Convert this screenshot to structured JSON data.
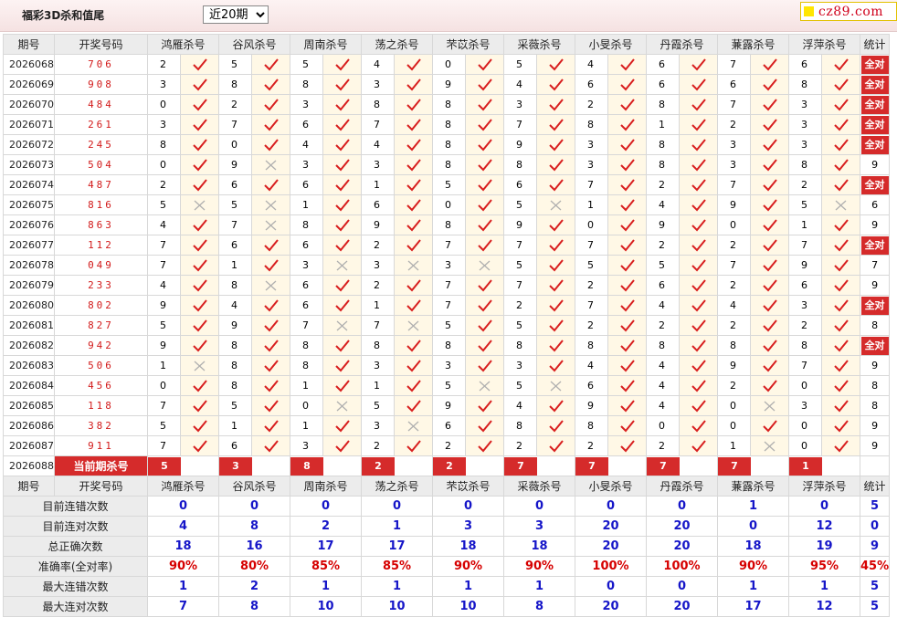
{
  "header": {
    "title": "福彩3D杀和值尾",
    "period_select": {
      "value": "近20期",
      "options": [
        "近20期"
      ]
    },
    "logo_text": "cz89.com"
  },
  "colors": {
    "accent": "#d52b2b",
    "stat_blue": "#1515c8",
    "check": "#d81e1e",
    "cross": "#b0b0b0",
    "mark_bg": "#fff8e6"
  },
  "table": {
    "columns": {
      "issue": "期号",
      "draw": "开奖号码",
      "stat": "统计"
    },
    "experts": [
      "鸿雁杀号",
      "谷风杀号",
      "周南杀号",
      "荡之杀号",
      "芣苡杀号",
      "采薇杀号",
      "小旻杀号",
      "丹霞杀号",
      "蒹露杀号",
      "浮萍杀号"
    ],
    "rows": [
      {
        "issue": "2026068",
        "draw": "706",
        "picks": [
          [
            "2",
            "hit"
          ],
          [
            "5",
            "hit"
          ],
          [
            "5",
            "hit"
          ],
          [
            "4",
            "hit"
          ],
          [
            "0",
            "hit"
          ],
          [
            "5",
            "hit"
          ],
          [
            "4",
            "hit"
          ],
          [
            "6",
            "hit"
          ],
          [
            "7",
            "hit"
          ],
          [
            "6",
            "hit"
          ]
        ],
        "stat": "全对",
        "all": true
      },
      {
        "issue": "2026069",
        "draw": "908",
        "picks": [
          [
            "3",
            "hit"
          ],
          [
            "8",
            "hit"
          ],
          [
            "8",
            "hit"
          ],
          [
            "3",
            "hit"
          ],
          [
            "9",
            "hit"
          ],
          [
            "4",
            "hit"
          ],
          [
            "6",
            "hit"
          ],
          [
            "6",
            "hit"
          ],
          [
            "6",
            "hit"
          ],
          [
            "8",
            "hit"
          ]
        ],
        "stat": "全对",
        "all": true
      },
      {
        "issue": "2026070",
        "draw": "484",
        "picks": [
          [
            "0",
            "hit"
          ],
          [
            "2",
            "hit"
          ],
          [
            "3",
            "hit"
          ],
          [
            "8",
            "hit"
          ],
          [
            "8",
            "hit"
          ],
          [
            "3",
            "hit"
          ],
          [
            "2",
            "hit"
          ],
          [
            "8",
            "hit"
          ],
          [
            "7",
            "hit"
          ],
          [
            "3",
            "hit"
          ]
        ],
        "stat": "全对",
        "all": true
      },
      {
        "issue": "2026071",
        "draw": "261",
        "picks": [
          [
            "3",
            "hit"
          ],
          [
            "7",
            "hit"
          ],
          [
            "6",
            "hit"
          ],
          [
            "7",
            "hit"
          ],
          [
            "8",
            "hit"
          ],
          [
            "7",
            "hit"
          ],
          [
            "8",
            "hit"
          ],
          [
            "1",
            "hit"
          ],
          [
            "2",
            "hit"
          ],
          [
            "3",
            "hit"
          ]
        ],
        "stat": "全对",
        "all": true
      },
      {
        "issue": "2026072",
        "draw": "245",
        "picks": [
          [
            "8",
            "hit"
          ],
          [
            "0",
            "hit"
          ],
          [
            "4",
            "hit"
          ],
          [
            "4",
            "hit"
          ],
          [
            "8",
            "hit"
          ],
          [
            "9",
            "hit"
          ],
          [
            "3",
            "hit"
          ],
          [
            "8",
            "hit"
          ],
          [
            "3",
            "hit"
          ],
          [
            "3",
            "hit"
          ]
        ],
        "stat": "全对",
        "all": true
      },
      {
        "issue": "2026073",
        "draw": "504",
        "picks": [
          [
            "0",
            "hit"
          ],
          [
            "9",
            "miss"
          ],
          [
            "3",
            "hit"
          ],
          [
            "3",
            "hit"
          ],
          [
            "8",
            "hit"
          ],
          [
            "8",
            "hit"
          ],
          [
            "3",
            "hit"
          ],
          [
            "8",
            "hit"
          ],
          [
            "3",
            "hit"
          ],
          [
            "8",
            "hit"
          ]
        ],
        "stat": "9",
        "all": false
      },
      {
        "issue": "2026074",
        "draw": "487",
        "picks": [
          [
            "2",
            "hit"
          ],
          [
            "6",
            "hit"
          ],
          [
            "6",
            "hit"
          ],
          [
            "1",
            "hit"
          ],
          [
            "5",
            "hit"
          ],
          [
            "6",
            "hit"
          ],
          [
            "7",
            "hit"
          ],
          [
            "2",
            "hit"
          ],
          [
            "7",
            "hit"
          ],
          [
            "2",
            "hit"
          ]
        ],
        "stat": "全对",
        "all": true
      },
      {
        "issue": "2026075",
        "draw": "816",
        "picks": [
          [
            "5",
            "miss"
          ],
          [
            "5",
            "miss"
          ],
          [
            "1",
            "hit"
          ],
          [
            "6",
            "hit"
          ],
          [
            "0",
            "hit"
          ],
          [
            "5",
            "miss"
          ],
          [
            "1",
            "hit"
          ],
          [
            "4",
            "hit"
          ],
          [
            "9",
            "hit"
          ],
          [
            "5",
            "miss"
          ]
        ],
        "stat": "6",
        "all": false
      },
      {
        "issue": "2026076",
        "draw": "863",
        "picks": [
          [
            "4",
            "hit"
          ],
          [
            "7",
            "miss"
          ],
          [
            "8",
            "hit"
          ],
          [
            "9",
            "hit"
          ],
          [
            "8",
            "hit"
          ],
          [
            "9",
            "hit"
          ],
          [
            "0",
            "hit"
          ],
          [
            "9",
            "hit"
          ],
          [
            "0",
            "hit"
          ],
          [
            "1",
            "hit"
          ]
        ],
        "stat": "9",
        "all": false
      },
      {
        "issue": "2026077",
        "draw": "112",
        "picks": [
          [
            "7",
            "hit"
          ],
          [
            "6",
            "hit"
          ],
          [
            "6",
            "hit"
          ],
          [
            "2",
            "hit"
          ],
          [
            "7",
            "hit"
          ],
          [
            "7",
            "hit"
          ],
          [
            "7",
            "hit"
          ],
          [
            "2",
            "hit"
          ],
          [
            "2",
            "hit"
          ],
          [
            "7",
            "hit"
          ]
        ],
        "stat": "全对",
        "all": true
      },
      {
        "issue": "2026078",
        "draw": "049",
        "picks": [
          [
            "7",
            "hit"
          ],
          [
            "1",
            "hit"
          ],
          [
            "3",
            "miss"
          ],
          [
            "3",
            "miss"
          ],
          [
            "3",
            "miss"
          ],
          [
            "5",
            "hit"
          ],
          [
            "5",
            "hit"
          ],
          [
            "5",
            "hit"
          ],
          [
            "7",
            "hit"
          ],
          [
            "9",
            "hit"
          ]
        ],
        "stat": "7",
        "all": false
      },
      {
        "issue": "2026079",
        "draw": "233",
        "picks": [
          [
            "4",
            "hit"
          ],
          [
            "8",
            "miss"
          ],
          [
            "6",
            "hit"
          ],
          [
            "2",
            "hit"
          ],
          [
            "7",
            "hit"
          ],
          [
            "7",
            "hit"
          ],
          [
            "2",
            "hit"
          ],
          [
            "6",
            "hit"
          ],
          [
            "2",
            "hit"
          ],
          [
            "6",
            "hit"
          ]
        ],
        "stat": "9",
        "all": false
      },
      {
        "issue": "2026080",
        "draw": "802",
        "picks": [
          [
            "9",
            "hit"
          ],
          [
            "4",
            "hit"
          ],
          [
            "6",
            "hit"
          ],
          [
            "1",
            "hit"
          ],
          [
            "7",
            "hit"
          ],
          [
            "2",
            "hit"
          ],
          [
            "7",
            "hit"
          ],
          [
            "4",
            "hit"
          ],
          [
            "4",
            "hit"
          ],
          [
            "3",
            "hit"
          ]
        ],
        "stat": "全对",
        "all": true
      },
      {
        "issue": "2026081",
        "draw": "827",
        "picks": [
          [
            "5",
            "hit"
          ],
          [
            "9",
            "hit"
          ],
          [
            "7",
            "miss"
          ],
          [
            "7",
            "miss"
          ],
          [
            "5",
            "hit"
          ],
          [
            "5",
            "hit"
          ],
          [
            "2",
            "hit"
          ],
          [
            "2",
            "hit"
          ],
          [
            "2",
            "hit"
          ],
          [
            "2",
            "hit"
          ]
        ],
        "stat": "8",
        "all": false
      },
      {
        "issue": "2026082",
        "draw": "942",
        "picks": [
          [
            "9",
            "hit"
          ],
          [
            "8",
            "hit"
          ],
          [
            "8",
            "hit"
          ],
          [
            "8",
            "hit"
          ],
          [
            "8",
            "hit"
          ],
          [
            "8",
            "hit"
          ],
          [
            "8",
            "hit"
          ],
          [
            "8",
            "hit"
          ],
          [
            "8",
            "hit"
          ],
          [
            "8",
            "hit"
          ]
        ],
        "stat": "全对",
        "all": true
      },
      {
        "issue": "2026083",
        "draw": "506",
        "picks": [
          [
            "1",
            "miss"
          ],
          [
            "8",
            "hit"
          ],
          [
            "8",
            "hit"
          ],
          [
            "3",
            "hit"
          ],
          [
            "3",
            "hit"
          ],
          [
            "3",
            "hit"
          ],
          [
            "4",
            "hit"
          ],
          [
            "4",
            "hit"
          ],
          [
            "9",
            "hit"
          ],
          [
            "7",
            "hit"
          ]
        ],
        "stat": "9",
        "all": false
      },
      {
        "issue": "2026084",
        "draw": "456",
        "picks": [
          [
            "0",
            "hit"
          ],
          [
            "8",
            "hit"
          ],
          [
            "1",
            "hit"
          ],
          [
            "1",
            "hit"
          ],
          [
            "5",
            "miss"
          ],
          [
            "5",
            "miss"
          ],
          [
            "6",
            "hit"
          ],
          [
            "4",
            "hit"
          ],
          [
            "2",
            "hit"
          ],
          [
            "0",
            "hit"
          ]
        ],
        "stat": "8",
        "all": false
      },
      {
        "issue": "2026085",
        "draw": "118",
        "picks": [
          [
            "7",
            "hit"
          ],
          [
            "5",
            "hit"
          ],
          [
            "0",
            "miss"
          ],
          [
            "5",
            "hit"
          ],
          [
            "9",
            "hit"
          ],
          [
            "4",
            "hit"
          ],
          [
            "9",
            "hit"
          ],
          [
            "4",
            "hit"
          ],
          [
            "0",
            "miss"
          ],
          [
            "3",
            "hit"
          ]
        ],
        "stat": "8",
        "all": false
      },
      {
        "issue": "2026086",
        "draw": "382",
        "picks": [
          [
            "5",
            "hit"
          ],
          [
            "1",
            "hit"
          ],
          [
            "1",
            "hit"
          ],
          [
            "3",
            "miss"
          ],
          [
            "6",
            "hit"
          ],
          [
            "8",
            "hit"
          ],
          [
            "8",
            "hit"
          ],
          [
            "0",
            "hit"
          ],
          [
            "0",
            "hit"
          ],
          [
            "0",
            "hit"
          ]
        ],
        "stat": "9",
        "all": false
      },
      {
        "issue": "2026087",
        "draw": "911",
        "picks": [
          [
            "7",
            "hit"
          ],
          [
            "6",
            "hit"
          ],
          [
            "3",
            "hit"
          ],
          [
            "2",
            "hit"
          ],
          [
            "2",
            "hit"
          ],
          [
            "2",
            "hit"
          ],
          [
            "2",
            "hit"
          ],
          [
            "2",
            "hit"
          ],
          [
            "1",
            "miss"
          ],
          [
            "0",
            "hit"
          ]
        ],
        "stat": "9",
        "all": false
      }
    ],
    "current": {
      "issue": "2026088",
      "label": "当前期杀号",
      "picks": [
        "5",
        "3",
        "8",
        "2",
        "2",
        "7",
        "7",
        "7",
        "7",
        "1"
      ]
    }
  },
  "stats": {
    "rows": [
      {
        "label": "目前连错次数",
        "values": [
          "0",
          "0",
          "0",
          "0",
          "0",
          "0",
          "0",
          "0",
          "1",
          "0"
        ],
        "stat": "5",
        "red": false
      },
      {
        "label": "目前连对次数",
        "values": [
          "4",
          "8",
          "2",
          "1",
          "3",
          "3",
          "20",
          "20",
          "0",
          "12"
        ],
        "stat": "0",
        "red": false
      },
      {
        "label": "总正确次数",
        "values": [
          "18",
          "16",
          "17",
          "17",
          "18",
          "18",
          "20",
          "20",
          "18",
          "19"
        ],
        "stat": "9",
        "red": false
      },
      {
        "label": "准确率(全对率)",
        "values": [
          "90%",
          "80%",
          "85%",
          "85%",
          "90%",
          "90%",
          "100%",
          "100%",
          "90%",
          "95%"
        ],
        "stat": "45%",
        "red": true
      },
      {
        "label": "最大连错次数",
        "values": [
          "1",
          "2",
          "1",
          "1",
          "1",
          "1",
          "0",
          "0",
          "1",
          "1"
        ],
        "stat": "5",
        "red": false
      },
      {
        "label": "最大连对次数",
        "values": [
          "7",
          "8",
          "10",
          "10",
          "10",
          "8",
          "20",
          "20",
          "17",
          "12"
        ],
        "stat": "5",
        "red": false
      }
    ]
  }
}
